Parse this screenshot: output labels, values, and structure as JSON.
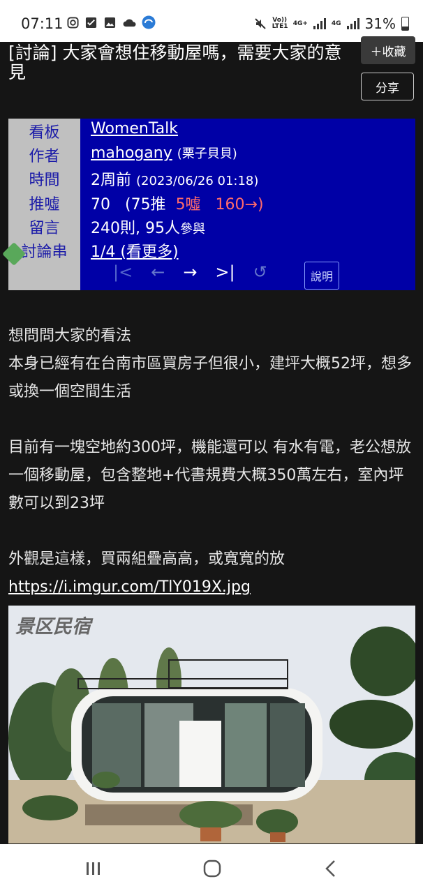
{
  "status_bar": {
    "time": "07:11",
    "net_volte": "Vo)) LTE1",
    "net_4g_plus": "4G+",
    "net_4g": "4G",
    "battery": "31%",
    "icons": [
      "instagram-icon",
      "check-box-icon",
      "gallery-icon",
      "cloud-icon",
      "sync-app-icon",
      "mute-icon",
      "signal-icon",
      "signal-icon",
      "battery-icon"
    ]
  },
  "header": {
    "title": "[討論] 大家會想住移動屋嗎，需要大家的意見",
    "fav_button": "＋收藏",
    "share_button": "分享"
  },
  "meta": {
    "labels": {
      "board": "看板",
      "author": "作者",
      "time": "時間",
      "votes": "推噓",
      "comments": "留言",
      "thread": "討論串"
    },
    "board": "WomenTalk",
    "author_id": "mahogany",
    "author_nick": "(栗子貝貝)",
    "time_rel": "2周前",
    "time_abs": "(2023/06/26 01:18)",
    "score": "70",
    "push": "(75推",
    "boo": "5噓",
    "arrow": "160→)",
    "comment_count": "240則,",
    "participants": "95人",
    "participants_suffix": "參與",
    "thread": "1/4 (看更多)",
    "help_button": "說明",
    "colors": {
      "panel": "#0000a6",
      "label_bg": "#c0c0c0",
      "label_text": "#1b1ba8",
      "boo": "#ff6b6b"
    }
  },
  "content": {
    "line1": "想問問大家的看法",
    "line2": "本身已經有在台南市區買房子但很小，建坪大概52坪，想多或換一個空間生活",
    "line3": "目前有一塊空地約300坪，機能還可以 有水有電，老公想放一個移動屋，包含整地+代書規費大概350萬左右，室內坪數可以到23坪",
    "line4": "外觀是這樣，買兩組疊高高，或寬寬的放",
    "link": "https://i.imgur.com/TlY019X.jpg"
  },
  "image": {
    "watermark": "景区民宿"
  }
}
